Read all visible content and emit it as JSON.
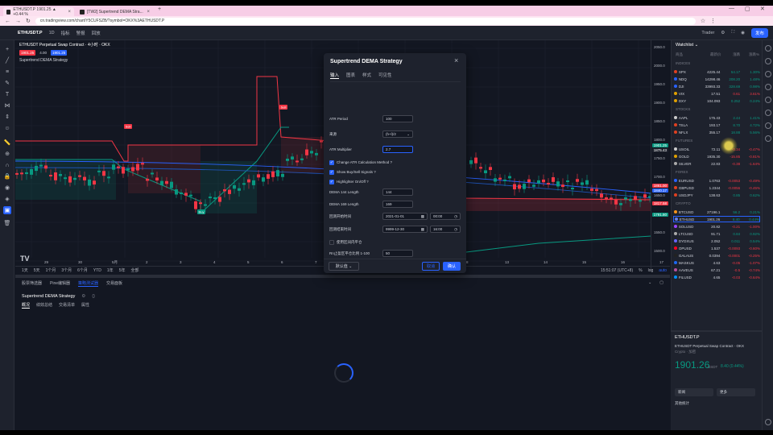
{
  "browser": {
    "tabs": [
      {
        "label": "ETHUSDT.P 1901.25 ▲ +0.44 %"
      },
      {
        "label": "[TW2] Supertrend DEMA Stra..."
      }
    ],
    "url": "cn.tradingview.com/chart/Y5CUFSZB/?symbol=OKX%3AETHUSDT.P"
  },
  "topbar": {
    "symbol": "ETHUSDT.P",
    "interval": "1D",
    "items": [
      "指标",
      "警报",
      "回放"
    ],
    "trader_label": "Trader",
    "publish": "发布"
  },
  "chart": {
    "title": "ETHUSDT Perpetual Swap Contract · 4小时 · OKX",
    "study": "Supertrend DEMA Strategy",
    "price_boxes": [
      "1901.25",
      "4.00",
      "1901.25"
    ],
    "price_ticks": [
      "2050.0",
      "2000.0",
      "1950.0",
      "1900.0",
      "1850.0",
      "1800.0",
      "1750.0",
      "1700.0",
      "1650.0",
      "1600.0",
      "1550.0",
      "1500.0"
    ],
    "price_tags": [
      {
        "text": "1901.25",
        "color": "#089981"
      },
      {
        "text": "1875.43",
        "color": "#1e222d"
      },
      {
        "text": "1861.00",
        "color": "#f23645"
      },
      {
        "text": "1840.17",
        "color": "#2962ff"
      },
      {
        "text": "1817.58",
        "color": "#f23645"
      },
      {
        "text": "1791.80",
        "color": "#089981"
      }
    ],
    "time_ticks": [
      "29",
      "30",
      "5月",
      "2",
      "3",
      "4",
      "5",
      "6",
      "7",
      "8",
      "13",
      "14",
      "15",
      "16",
      "17",
      "18"
    ],
    "signals": [
      "Sell",
      "Sell",
      "Buy"
    ],
    "colors": {
      "up": "#089981",
      "down": "#f23645",
      "line_blue": "#2962ff"
    }
  },
  "rangebar": {
    "ranges": [
      "1天",
      "5天",
      "1个月",
      "3个月",
      "6个月",
      "YTD",
      "1年",
      "5年",
      "全部"
    ],
    "clock": "15:51:07 (UTC+8)",
    "log": "%",
    "scale": "log",
    "auto": "auto"
  },
  "bottom": {
    "tabs": [
      "股票筛选器",
      "Pine编辑器",
      "策略测试器",
      "交易面板"
    ],
    "active_tab": 2,
    "strategy_name": "Supertrend DEMA Strategy",
    "subtabs": [
      "概况",
      "绩效总结",
      "交易清单",
      "属性"
    ]
  },
  "dialog": {
    "title": "Supertrend DEMA Strategy",
    "tabs": [
      "输入",
      "图表",
      "样式",
      "可见性"
    ],
    "fields": [
      {
        "label": "ATR Period",
        "value": "100"
      },
      {
        "label": "来源",
        "value": "(h+l)/2"
      },
      {
        "label": "ATR Multiplier",
        "value": "2.7"
      }
    ],
    "checks": [
      {
        "label": "Change ATR Calculation Method ?",
        "checked": true
      },
      {
        "label": "Show Buy/Sell Signals ?",
        "checked": true
      },
      {
        "label": "Highlighter On/Off ?",
        "checked": true
      }
    ],
    "dema_fields": [
      {
        "label": "DEMA 144 Length",
        "value": "144"
      },
      {
        "label": "DEMA 169 Length",
        "value": "169"
      }
    ],
    "start": {
      "label": "回测开始时间",
      "date": "2021-01-01",
      "time": "00:00"
    },
    "end": {
      "label": "回测结束时间",
      "date": "9999-12-30",
      "time": "16:00"
    },
    "close_check": {
      "label": "使用区间内平仓",
      "checked": false
    },
    "ratio": {
      "label": "Rn止盈区平仓比例 1-100",
      "value": "50"
    },
    "footer": {
      "defaults": "默认值",
      "cancel": "取消",
      "ok": "确认"
    }
  },
  "watchlist": {
    "title": "Watchlist",
    "columns": [
      "商品",
      "最新价",
      "涨跌",
      "涨跌%"
    ],
    "sections": [
      {
        "name": "INDICES",
        "rows": [
          {
            "sym": "SPX",
            "last": "4225.44",
            "chg": "54.17",
            "pct": "1.30%",
            "up": true,
            "dot": "#e04020"
          },
          {
            "sym": "NDQ",
            "last": "14298.46",
            "chg": "208.20",
            "pct": "1.48%",
            "up": true,
            "dot": "#2962ff"
          },
          {
            "sym": "DJI",
            "last": "33993.33",
            "chg": "328.69",
            "pct": "0.98%",
            "up": true,
            "dot": "#2962ff"
          },
          {
            "sym": "VIX",
            "last": "17.51",
            "chg": "0.61",
            "pct": "3.61%",
            "up": false,
            "dot": "#e0a000"
          },
          {
            "sym": "DXY",
            "last": "104.093",
            "chg": "0.252",
            "pct": "0.24%",
            "up": true,
            "dot": "#e0a000"
          }
        ]
      },
      {
        "name": "STOCKS",
        "rows": [
          {
            "sym": "AAPL",
            "last": "175.43",
            "chg": "2.44",
            "pct": "1.41%",
            "up": true,
            "dot": "#ccc"
          },
          {
            "sym": "TSLA",
            "last": "193.17",
            "chg": "8.70",
            "pct": "4.72%",
            "up": true,
            "dot": "#e04020"
          },
          {
            "sym": "NFLX",
            "last": "355.17",
            "chg": "18.88",
            "pct": "5.56%",
            "up": true,
            "dot": "#e04020"
          }
        ]
      },
      {
        "name": "FUTURES",
        "rows": [
          {
            "sym": "USOIL",
            "last": "72.11",
            "chg": "-0.34",
            "pct": "-0.47%",
            "up": false,
            "dot": "#ccc"
          },
          {
            "sym": "GOLD",
            "last": "1935.30",
            "chg": "-15.85",
            "pct": "-0.81%",
            "up": false,
            "dot": "#e0a000"
          },
          {
            "sym": "SILVER",
            "last": "22.83",
            "chg": "-0.38",
            "pct": "-1.64%",
            "up": false,
            "dot": "#aaa"
          }
        ]
      },
      {
        "name": "FOREX",
        "rows": [
          {
            "sym": "EURUSD",
            "last": "1.0763",
            "chg": "-0.0053",
            "pct": "-0.49%",
            "up": false,
            "dot": "#2962ff"
          },
          {
            "sym": "GBPUSD",
            "last": "1.2344",
            "chg": "-0.0056",
            "pct": "-0.45%",
            "up": false,
            "dot": "#e04020"
          },
          {
            "sym": "USDJPY",
            "last": "138.63",
            "chg": "0.85",
            "pct": "0.62%",
            "up": true,
            "dot": "#e04020"
          }
        ]
      },
      {
        "name": "CRYPTO",
        "rows": [
          {
            "sym": "BTCUSD",
            "last": "27196.1",
            "chg": "56.2",
            "pct": "0.21%",
            "up": true,
            "dot": "#f7931a"
          },
          {
            "sym": "ETHUSD",
            "last": "1901.26",
            "chg": "8.40",
            "pct": "0.44%",
            "up": true,
            "dot": "#627eea",
            "selected": true
          },
          {
            "sym": "SOLUSD",
            "last": "20.82",
            "chg": "-0.21",
            "pct": "-1.00%",
            "up": false,
            "dot": "#9945ff"
          },
          {
            "sym": "LTCUSD",
            "last": "91.71",
            "chg": "0.84",
            "pct": "0.92%",
            "up": true,
            "dot": "#aaa"
          },
          {
            "sym": "DYDXUS",
            "last": "2.052",
            "chg": "0.011",
            "pct": "0.54%",
            "up": true,
            "dot": "#6966ff"
          },
          {
            "sym": "OPUSD",
            "last": "1.537",
            "chg": "-0.0093",
            "pct": "-0.60%",
            "up": false,
            "dot": "#ff0420"
          },
          {
            "sym": "GALAUS",
            "last": "0.0394",
            "chg": "-0.0001",
            "pct": "-0.25%",
            "up": false,
            "dot": "#222"
          },
          {
            "sym": "MASKUS",
            "last": "4.63",
            "chg": "-0.05",
            "pct": "-1.07%",
            "up": false,
            "dot": "#1c68f3"
          },
          {
            "sym": "AAVEUS",
            "last": "67.21",
            "chg": "-0.5",
            "pct": "-0.74%",
            "up": false,
            "dot": "#b6509e"
          },
          {
            "sym": "FILUSD",
            "last": "4.65",
            "chg": "-0.03",
            "pct": "-0.64%",
            "up": false,
            "dot": "#0090ff"
          }
        ]
      }
    ]
  },
  "detail": {
    "symbol": "ETHUSDT.P",
    "desc": "ETHUSDT Perpetual Swap Contract · OKX",
    "type": "Crypto · 加密",
    "price": "1901.26",
    "unit": "USDT",
    "change": "8.40 (0.44%)",
    "buttons": [
      "新闻",
      "更多"
    ],
    "more": "其他统计"
  }
}
